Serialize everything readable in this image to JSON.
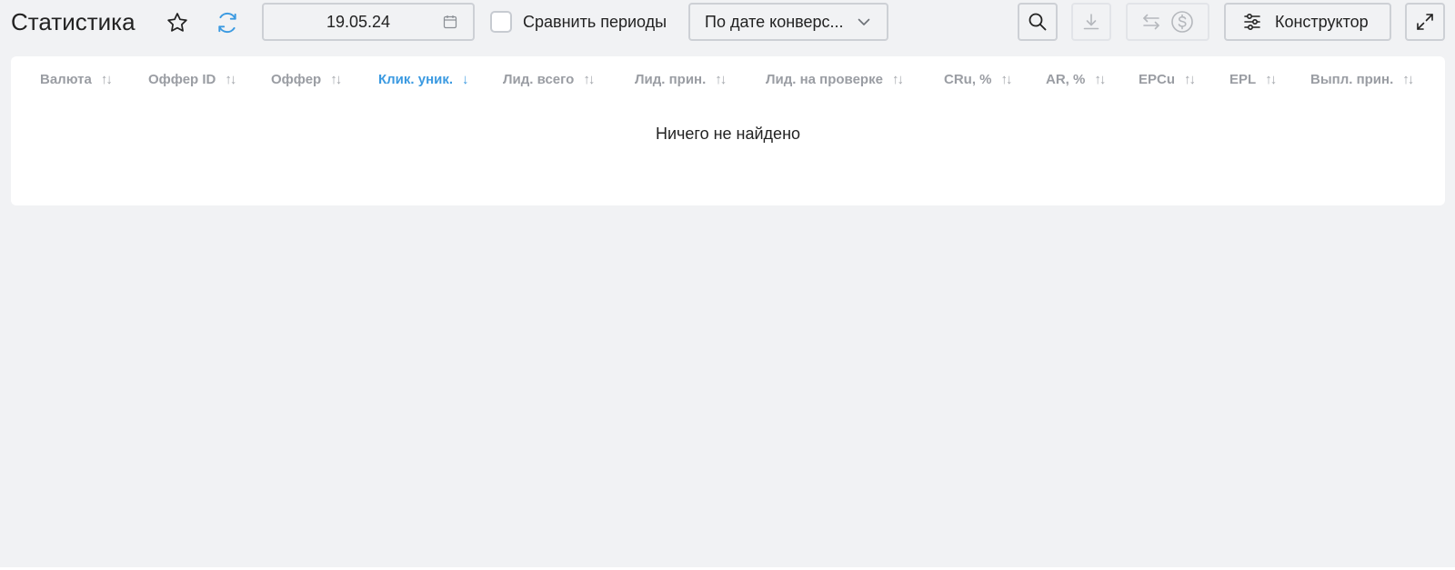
{
  "header": {
    "title": "Статистика",
    "date_value": "19.05.24",
    "compare_label": "Сравнить периоды",
    "compare_checked": false,
    "date_mode_selected": "По дате конверс...",
    "constructor_label": "Конструктор"
  },
  "icons": {
    "favorite": "star-icon",
    "refresh": "refresh-icon",
    "calendar": "calendar-icon",
    "dropdown": "chevron-down-icon",
    "search": "search-icon",
    "download": "download-icon",
    "swap": "swap-arrows-icon",
    "currency": "dollar-circle-icon",
    "settings": "sliders-icon",
    "expand": "expand-icon"
  },
  "table": {
    "columns": [
      {
        "label": "Валюта",
        "sort": "↑↓"
      },
      {
        "label": "Оффер ID",
        "sort": "↑↓"
      },
      {
        "label": "Оффер",
        "sort": "↑↓"
      },
      {
        "label": "Клик. уник.",
        "sort": "↓"
      },
      {
        "label": "Лид. всего",
        "sort": "↑↓"
      },
      {
        "label": "Лид. прин.",
        "sort": "↑↓"
      },
      {
        "label": "Лид. на проверке",
        "sort": "↑↓"
      },
      {
        "label": "CRu, %",
        "sort": "↑↓"
      },
      {
        "label": "AR, %",
        "sort": "↑↓"
      },
      {
        "label": "EPCu",
        "sort": "↑↓"
      },
      {
        "label": "EPL",
        "sort": "↑↓"
      },
      {
        "label": "Выпл. прин.",
        "sort": "↑↓"
      }
    ],
    "empty_message": "Ничего не найдено"
  },
  "colors": {
    "background": "#f1f2f4",
    "panel": "#ffffff",
    "accent": "#3b9ae1",
    "header_text": "#9a9da3",
    "text": "#222222",
    "border": "#cdd0d5"
  }
}
